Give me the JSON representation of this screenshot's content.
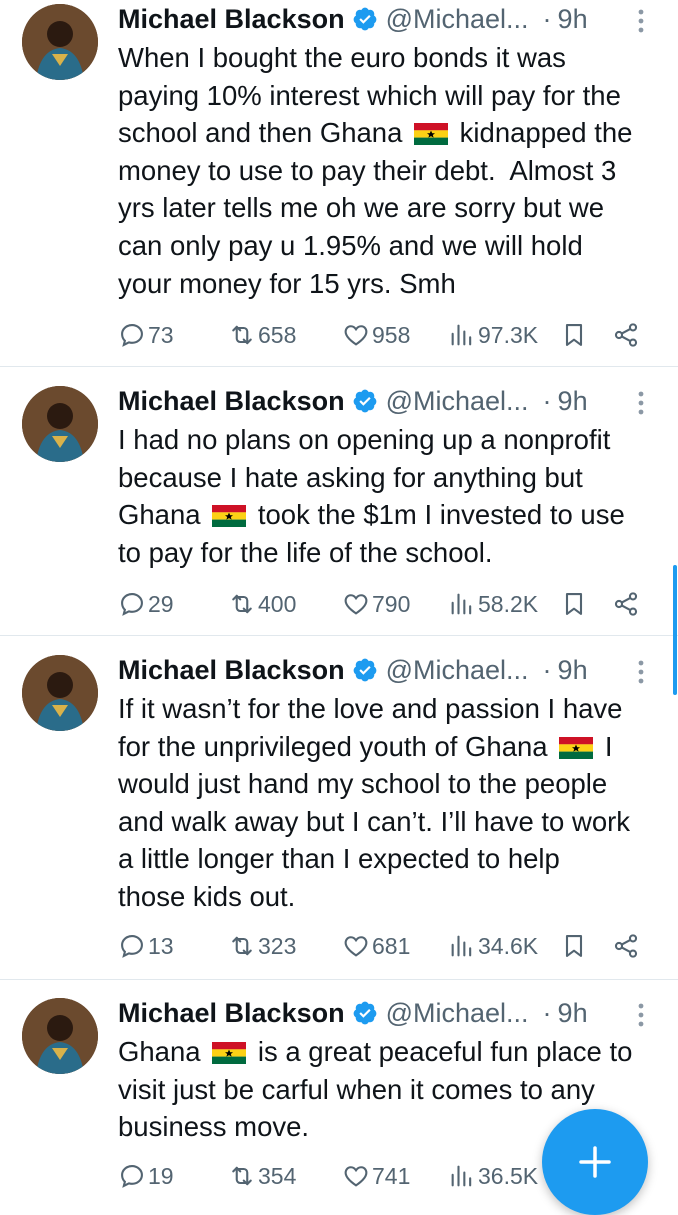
{
  "tweets": [
    {
      "author": "Michael Blackson",
      "handle": "@Michael...",
      "dot": "·",
      "time": "9h",
      "text_parts": [
        "When I bought the euro bonds it was\npaying 10% interest which will pay for the\nschool and then Ghana ",
        " kidnapped the\nmoney to use to pay their debt.  Almost 3\nyrs later tells me oh we are sorry but we\ncan only pay u 1.95% and we will hold\nyour money for 15 yrs. Smh"
      ],
      "replies": "73",
      "reposts": "658",
      "likes": "958",
      "views": "97.3K"
    },
    {
      "author": "Michael Blackson",
      "handle": "@Michael...",
      "dot": "·",
      "time": "9h",
      "text_parts": [
        "I had no plans on opening up a nonprofit\nbecause I hate asking for anything but\nGhana ",
        " took the $1m I invested to use\nto pay for the life of the school."
      ],
      "replies": "29",
      "reposts": "400",
      "likes": "790",
      "views": "58.2K"
    },
    {
      "author": "Michael Blackson",
      "handle": "@Michael...",
      "dot": "·",
      "time": "9h",
      "text_parts": [
        "If it wasn’t for the love and passion I have\nfor the unprivileged youth of Ghana ",
        " I\nwould just hand my school to the people\nand walk away but I can’t. I’ll have to work\na little longer than I expected to help\nthose kids out."
      ],
      "replies": "13",
      "reposts": "323",
      "likes": "681",
      "views": "34.6K"
    },
    {
      "author": "Michael Blackson",
      "handle": "@Michael...",
      "dot": "·",
      "time": "9h",
      "text_parts": [
        "Ghana ",
        " is a great peaceful fun place to\nvisit just be carful when it comes to any\nbusiness move."
      ],
      "replies": "19",
      "reposts": "354",
      "likes": "741",
      "views": "36.5K"
    }
  ],
  "icons": {
    "reply": "reply-icon",
    "repost": "repost-icon",
    "like": "heart-icon",
    "views": "views-icon",
    "bookmark": "bookmark-icon",
    "share": "share-icon",
    "more": "more-vertical-icon",
    "verified": "verified-badge-icon",
    "compose": "plus-icon"
  },
  "colors": {
    "accent": "#1d9bf0",
    "text": "#0f1419",
    "muted": "#536471",
    "divider": "#e1e8ed"
  }
}
